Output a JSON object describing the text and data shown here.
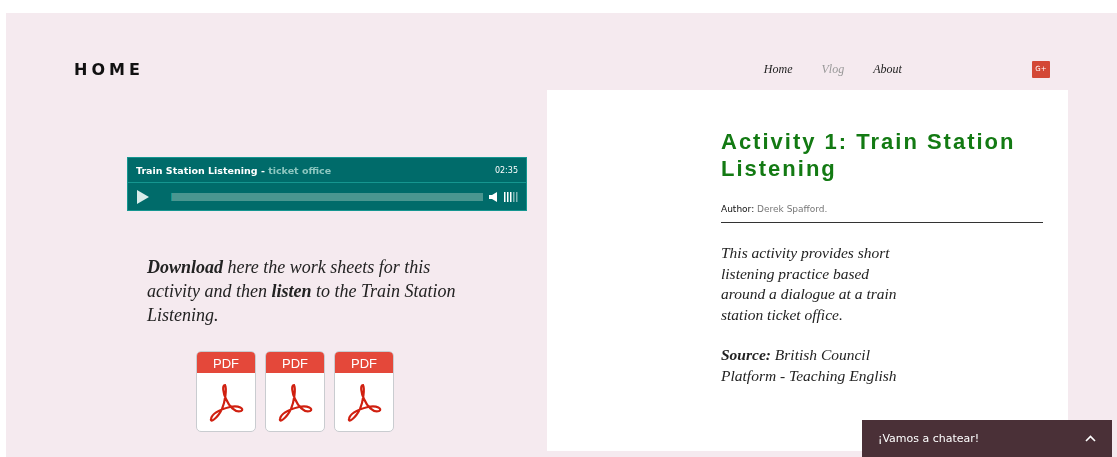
{
  "header": {
    "logo": "HOME",
    "nav": [
      {
        "label": "Home",
        "selected": false
      },
      {
        "label": "Vlog",
        "selected": true
      },
      {
        "label": "About",
        "selected": false
      }
    ],
    "social": "G+"
  },
  "player": {
    "title": "Train Station Listening - ",
    "subtitle": "ticket office",
    "duration": "02:35"
  },
  "intro": "**Download** here the work sheets for this activity and then **listen** to the Train Station Listening.",
  "downloads": [
    {
      "label": "PDF"
    },
    {
      "label": "PDF"
    },
    {
      "label": "PDF"
    }
  ],
  "article": {
    "title": "Activity 1: Train Station Listening",
    "author_label": "Author:",
    "author": "Derek Spafford.",
    "description": "This activity provides short listening practice based around a dialogue at a train station ticket office.",
    "source": "**Source:** British Council Platform - Teaching English"
  },
  "chat": {
    "label": "¡Vamos a chatear!",
    "expanded": false
  }
}
